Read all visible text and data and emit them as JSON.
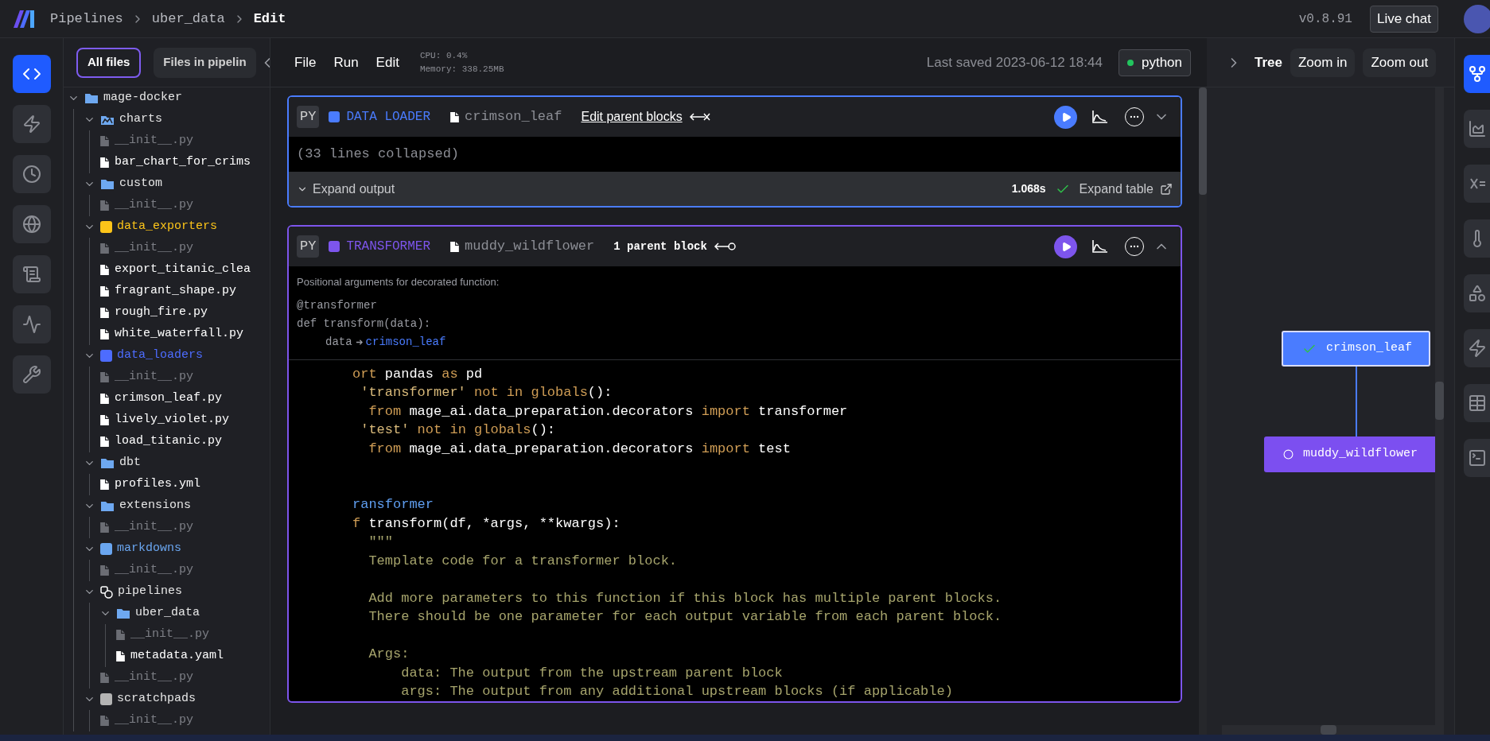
{
  "header": {
    "breadcrumbs": [
      {
        "label": "Pipelines",
        "current": false
      },
      {
        "label": "uber_data",
        "current": false
      },
      {
        "label": "Edit",
        "current": true
      }
    ],
    "version": "v0.8.91",
    "live_chat": "Live chat"
  },
  "left_rail": [
    {
      "selected": true
    },
    {
      "selected": false
    },
    {
      "selected": false
    },
    {
      "selected": false
    },
    {
      "selected": false
    },
    {
      "selected": false
    },
    {
      "selected": false
    }
  ],
  "file_tabs": [
    {
      "label": "All files",
      "selected": true
    },
    {
      "label": "Files in pipelin",
      "selected": false
    }
  ],
  "file_tree": [
    {
      "label": "mage-docker",
      "kind": "folder",
      "expanded": true,
      "children": [
        {
          "label": "charts",
          "kind": "chart_folder",
          "expanded": true,
          "children": [
            {
              "label": "__init__.py",
              "kind": "file",
              "dim": true
            },
            {
              "label": "bar_chart_for_crims",
              "kind": "file",
              "dim": false
            }
          ]
        },
        {
          "label": "custom",
          "kind": "folder",
          "expanded": true,
          "children": [
            {
              "label": "__init__.py",
              "kind": "file",
              "dim": true
            }
          ]
        },
        {
          "label": "data_exporters",
          "kind": "block_folder",
          "color": "#fcc419",
          "expanded": true,
          "children": [
            {
              "label": "__init__.py",
              "kind": "file",
              "dim": true
            },
            {
              "label": "export_titanic_clea",
              "kind": "file",
              "dim": false
            },
            {
              "label": "fragrant_shape.py",
              "kind": "file",
              "dim": false
            },
            {
              "label": "rough_fire.py",
              "kind": "file",
              "dim": false
            },
            {
              "label": "white_waterfall.py",
              "kind": "file",
              "dim": false
            }
          ]
        },
        {
          "label": "data_loaders",
          "kind": "block_folder",
          "color": "#4d6cff",
          "expanded": true,
          "children": [
            {
              "label": "__init__.py",
              "kind": "file",
              "dim": true
            },
            {
              "label": "crimson_leaf.py",
              "kind": "file",
              "dim": false
            },
            {
              "label": "lively_violet.py",
              "kind": "file",
              "dim": false
            },
            {
              "label": "load_titanic.py",
              "kind": "file",
              "dim": false
            }
          ]
        },
        {
          "label": "dbt",
          "kind": "folder",
          "expanded": true,
          "children": [
            {
              "label": "profiles.yml",
              "kind": "file",
              "dim": false
            }
          ]
        },
        {
          "label": "extensions",
          "kind": "folder",
          "expanded": true,
          "children": [
            {
              "label": "__init__.py",
              "kind": "file",
              "dim": true
            }
          ]
        },
        {
          "label": "markdowns",
          "kind": "block_folder",
          "color": "#6aa6f0",
          "expanded": true,
          "children": [
            {
              "label": "__init__.py",
              "kind": "file",
              "dim": true
            }
          ]
        },
        {
          "label": "pipelines",
          "kind": "pipeline_folder",
          "expanded": true,
          "children": [
            {
              "label": "uber_data",
              "kind": "folder",
              "expanded": true,
              "children": [
                {
                  "label": "__init__.py",
                  "kind": "file",
                  "dim": true
                },
                {
                  "label": "metadata.yaml",
                  "kind": "file",
                  "dim": false
                }
              ]
            },
            {
              "label": "__init__.py",
              "kind": "file",
              "dim": true
            }
          ]
        },
        {
          "label": "scratchpads",
          "kind": "block_folder",
          "color": "#b4b4b4",
          "expanded": true,
          "children": [
            {
              "label": "__init__.py",
              "kind": "file",
              "dim": true
            }
          ]
        }
      ]
    }
  ],
  "toolbar": {
    "menus": [
      "File",
      "Run",
      "Edit"
    ],
    "cpu": "CPU: 0.4%",
    "memory": "Memory: 338.25MB",
    "last_saved": "Last saved 2023-06-12 18:44",
    "kernel": {
      "label": "python",
      "active": true
    }
  },
  "blocks": [
    {
      "language": "PY",
      "type": "DATA LOADER",
      "color": "#4a7cff",
      "name": "crimson_leaf",
      "parent": {
        "kind": "edit",
        "label": "Edit parent blocks"
      },
      "expanded": false,
      "collapsed_note": "(33 lines collapsed)",
      "output": {
        "expand_label": "Expand output",
        "duration": "1.068s",
        "success": true,
        "expand_table": "Expand table"
      }
    },
    {
      "language": "PY",
      "type": "TRANSFORMER",
      "color": "#7d55ec",
      "name": "muddy_wildflower",
      "parent": {
        "kind": "count",
        "label": "1 parent block"
      },
      "expanded": true,
      "args_title": "Positional arguments for decorated function:",
      "signature": [
        "@transformer",
        "def transform(data):"
      ],
      "arg": {
        "name": "data",
        "target": "crimson_leaf"
      },
      "code": [
        {
          "kind": "code",
          "tokens": [
            {
              "text": "ort",
              "kind": "kw"
            },
            {
              "text": " pandas ",
              "kind": "name"
            },
            {
              "text": "as",
              "kind": "kw"
            },
            {
              "text": " pd",
              "kind": "name"
            }
          ]
        },
        {
          "kind": "code",
          "tokens": [
            {
              "text": " 'transformer'",
              "kind": "str"
            },
            {
              "text": " not in globals",
              "kind": "kw"
            },
            {
              "text": "():",
              "kind": "name"
            }
          ]
        },
        {
          "kind": "code",
          "tokens": [
            {
              "text": "  from",
              "kind": "kw"
            },
            {
              "text": " mage_ai.data_preparation.decorators ",
              "kind": "name"
            },
            {
              "text": "import",
              "kind": "kw"
            },
            {
              "text": " transformer",
              "kind": "name"
            }
          ]
        },
        {
          "kind": "code",
          "tokens": [
            {
              "text": " 'test'",
              "kind": "str"
            },
            {
              "text": " not in globals",
              "kind": "kw"
            },
            {
              "text": "():",
              "kind": "name"
            }
          ]
        },
        {
          "kind": "code",
          "tokens": [
            {
              "text": "  from",
              "kind": "kw"
            },
            {
              "text": " mage_ai.data_preparation.decorators ",
              "kind": "name"
            },
            {
              "text": "import",
              "kind": "kw"
            },
            {
              "text": " test",
              "kind": "name"
            }
          ]
        },
        {
          "kind": "blank"
        },
        {
          "kind": "blank"
        },
        {
          "kind": "code",
          "tokens": [
            {
              "text": "ransformer",
              "kind": "deco"
            }
          ]
        },
        {
          "kind": "code",
          "tokens": [
            {
              "text": "f",
              "kind": "kw"
            },
            {
              "text": " transform(df, *args, **kwargs):",
              "kind": "name"
            }
          ]
        },
        {
          "kind": "code",
          "tokens": [
            {
              "text": "  \"\"\"",
              "kind": "doc"
            }
          ]
        },
        {
          "kind": "code",
          "tokens": [
            {
              "text": "  Template code for a transformer block.",
              "kind": "doc"
            }
          ]
        },
        {
          "kind": "blank"
        },
        {
          "kind": "code",
          "tokens": [
            {
              "text": "  Add more parameters to this function if this block has multiple parent blocks.",
              "kind": "doc"
            }
          ]
        },
        {
          "kind": "code",
          "tokens": [
            {
              "text": "  There should be one parameter for each output variable from each parent block.",
              "kind": "doc"
            }
          ]
        },
        {
          "kind": "blank"
        },
        {
          "kind": "code",
          "tokens": [
            {
              "text": "  Args:",
              "kind": "doc"
            }
          ]
        },
        {
          "kind": "code",
          "tokens": [
            {
              "text": "      data: The output from the upstream parent block",
              "kind": "doc"
            }
          ]
        },
        {
          "kind": "code",
          "tokens": [
            {
              "text": "      args: The output from any additional upstream blocks (if applicable)",
              "kind": "doc"
            }
          ]
        }
      ]
    }
  ],
  "tree_panel": {
    "title": "Tree",
    "zoom_in": "Zoom in",
    "zoom_out": "Zoom out",
    "nodes": [
      {
        "name": "crimson_leaf",
        "color": "#4a7cff",
        "succeeded": true
      },
      {
        "name": "muddy_wildflower",
        "color": "#7c4ff0",
        "succeeded": false
      }
    ]
  },
  "right_rail": [
    {
      "selected": true
    },
    {
      "selected": false
    },
    {
      "selected": false
    },
    {
      "selected": false
    },
    {
      "selected": false
    },
    {
      "selected": false
    },
    {
      "selected": false
    },
    {
      "selected": false
    }
  ]
}
